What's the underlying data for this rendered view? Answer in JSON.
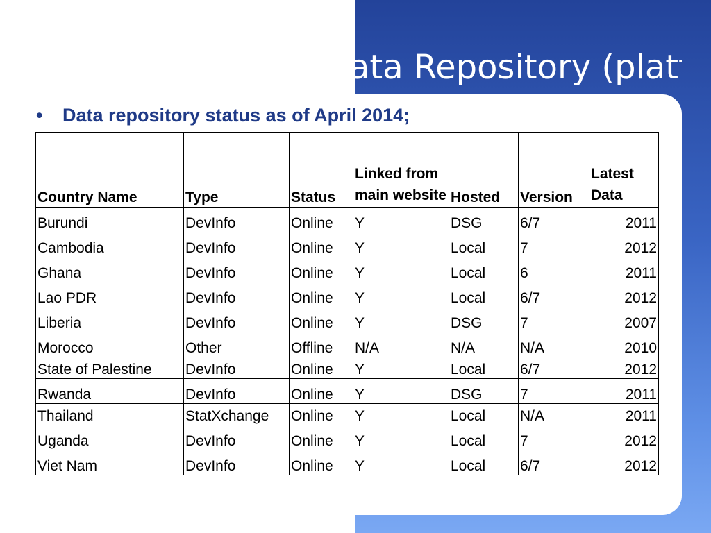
{
  "slide": {
    "title": "Data Repository (platform)",
    "bullet_symbol": "•",
    "bullet_text": "Data repository status as of April 2014;"
  },
  "table": {
    "headers": {
      "country": "Country Name",
      "type": "Type",
      "status": "Status",
      "linked": "Linked from main website",
      "hosted": "Hosted",
      "version": "Version",
      "latest": "Latest Data"
    },
    "rows": [
      {
        "country": "Burundi",
        "type": "DevInfo",
        "status": "Online",
        "linked": "Y",
        "hosted": "DSG",
        "version": "6/7",
        "latest": "2011"
      },
      {
        "country": "Cambodia",
        "type": "DevInfo",
        "status": "Online",
        "linked": "Y",
        "hosted": "Local",
        "version": "7",
        "latest": "2012"
      },
      {
        "country": "Ghana",
        "type": "DevInfo",
        "status": "Online",
        "linked": "Y",
        "hosted": "Local",
        "version": "6",
        "latest": "2011"
      },
      {
        "country": "Lao PDR",
        "type": "DevInfo",
        "status": "Online",
        "linked": "Y",
        "hosted": "Local",
        "version": "6/7",
        "latest": "2012"
      },
      {
        "country": "Liberia",
        "type": "DevInfo",
        "status": "Online",
        "linked": "Y",
        "hosted": "DSG",
        "version": "7",
        "latest": "2007"
      },
      {
        "country": "Morocco",
        "type": "Other",
        "status": "Offline",
        "linked": "N/A",
        "hosted": "N/A",
        "version": "N/A",
        "latest": "2010"
      },
      {
        "country": "State of Palestine",
        "type": "DevInfo",
        "status": "Online",
        "linked": "Y",
        "hosted": "Local",
        "version": "6/7",
        "latest": "2012"
      },
      {
        "country": "Rwanda",
        "type": "DevInfo",
        "status": "Online",
        "linked": "Y",
        "hosted": "DSG",
        "version": "7",
        "latest": "2011"
      },
      {
        "country": "Thailand",
        "type": "StatXchange",
        "status": "Online",
        "linked": "Y",
        "hosted": "Local",
        "version": "N/A",
        "latest": "2011"
      },
      {
        "country": "Uganda",
        "type": "DevInfo",
        "status": "Online",
        "linked": "Y",
        "hosted": "Local",
        "version": "7",
        "latest": "2012"
      },
      {
        "country": "Viet Nam",
        "type": "DevInfo",
        "status": "Online",
        "linked": "Y",
        "hosted": "Local",
        "version": "6/7",
        "latest": "2012"
      }
    ]
  },
  "colors": {
    "accent_blue": "#23439a",
    "gradient_light": "#7aa8f3",
    "bullet_text": "#1f3a87"
  }
}
